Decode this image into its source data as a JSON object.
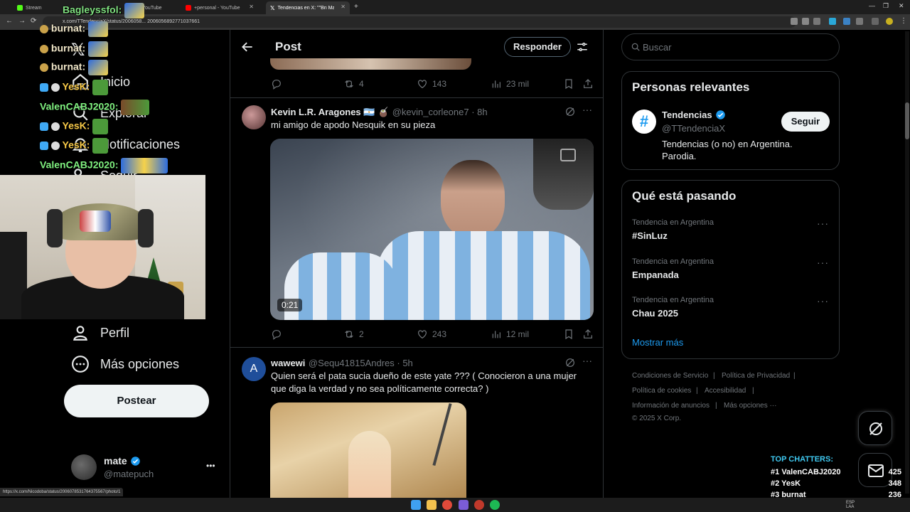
{
  "browser": {
    "tabs": [
      {
        "label": "Stream",
        "active": false
      },
      {
        "label": "YouTube",
        "active": false
      },
      {
        "label": "+personal - YouTube",
        "active": false
      },
      {
        "label": "Tendencias en X: \"\"Bri Marcos\"",
        "active": true
      }
    ],
    "url": "x.com/TTendenciaX/status/2006058... 2006056892771037661",
    "status_url": "https://x.com/Nicodoba/status/2006078531764375567/photo/1"
  },
  "sidebar": {
    "items": [
      "Inicio",
      "Explorar",
      "Notificaciones",
      "Seguir",
      "Perfil",
      "Más opciones"
    ],
    "post_button": "Postear",
    "account": {
      "name": "mate",
      "handle": "@matepuch",
      "more": "•••"
    }
  },
  "chat": {
    "lines": [
      {
        "user": "Bagleyssfol:",
        "color": "#7fe07f"
      },
      {
        "user": "burnat:",
        "color": "#f0e6c8"
      },
      {
        "user": "burnat:",
        "color": "#f0e6c8"
      },
      {
        "user": "burnat:",
        "color": "#f0e6c8"
      },
      {
        "user": "YesK:",
        "color": "#f7c948"
      },
      {
        "user": "ValenCABJ2020:",
        "color": "#7ff07f"
      },
      {
        "user": "YesK:",
        "color": "#f7c948"
      },
      {
        "user": "YesK:",
        "color": "#f7c948"
      },
      {
        "user": "ValenCABJ2020:",
        "color": "#7ff07f"
      }
    ]
  },
  "post_header": {
    "title": "Post",
    "reply_button": "Responder"
  },
  "tweets": [
    {
      "stats": {
        "replies": "",
        "retweets": "4",
        "likes": "143",
        "views": "23 mil"
      }
    },
    {
      "name": "Kevin L.R. Aragones 🇦🇷 🧉",
      "handle": "@kevin_corleone7 · 8h",
      "text": "mi amigo de apodo Nesquik en su pieza",
      "video_time": "0:21",
      "stats": {
        "replies": "",
        "retweets": "2",
        "likes": "243",
        "views": "12 mil"
      }
    },
    {
      "name": "wawewi",
      "handle": "@Sequ41815Andres · 5h",
      "avatar_letter": "A",
      "text": "Quien será el pata sucia dueño de este yate ??? ( Conocieron a una mujer que diga la verdad y no sea políticamente correcta? )"
    }
  ],
  "search": {
    "placeholder": "Buscar"
  },
  "relevant": {
    "title": "Personas relevantes",
    "name": "Tendencias",
    "handle": "@TTendenciaX",
    "bio": "Tendencias (o no) en Argentina. Parodia.",
    "follow": "Seguir"
  },
  "trends": {
    "title": "Qué está pasando",
    "items": [
      {
        "category": "Tendencia en Argentina",
        "name": "#SinLuz"
      },
      {
        "category": "Tendencia en Argentina",
        "name": "Empanada"
      },
      {
        "category": "Tendencia en Argentina",
        "name": "Chau 2025"
      }
    ],
    "show_more": "Mostrar más"
  },
  "footer": {
    "links": [
      "Condiciones de Servicio",
      "Política de Privacidad",
      "Política de cookies",
      "Accesibilidad",
      "Información de anuncios",
      "Más opciones ···"
    ],
    "copyright": "© 2025 X Corp."
  },
  "top_chatters": {
    "title": "TOP CHATTERS:",
    "rows": [
      {
        "rank": "#1",
        "name": "ValenCABJ2020",
        "count": "425"
      },
      {
        "rank": "#2",
        "name": "YesK",
        "count": "348"
      },
      {
        "rank": "#3",
        "name": "burnat",
        "count": "236"
      }
    ]
  },
  "taskbar": {
    "lang": "ESP LAA"
  },
  "colors": {
    "accent": "#1d9bf0",
    "bg": "#000000",
    "border": "#2f3336",
    "muted": "#71767b"
  }
}
